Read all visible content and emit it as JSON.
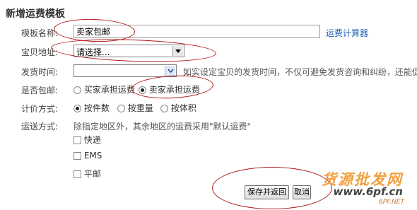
{
  "page_title": "新增运费模板",
  "template_name": {
    "label": "模板名称:",
    "value": "卖家包邮",
    "calc_link": "运费计算器"
  },
  "location": {
    "label": "宝贝地址:",
    "value": "请选择..."
  },
  "ship_time": {
    "label": "发货时间:",
    "value": "",
    "hint": "如实设定宝贝的发货时间，不仅可避免发货咨询和纠纷，还能促"
  },
  "free_shipping": {
    "label": "是否包邮:",
    "options": [
      "买家承担运费",
      "卖家承担运费"
    ],
    "selected": "卖家承担运费"
  },
  "pricing": {
    "label": "计价方式:",
    "options": [
      "按件数",
      "按重量",
      "按体积"
    ],
    "selected": "按件数"
  },
  "delivery": {
    "label": "运送方式:",
    "note": "除指定地区外，其余地区的运费采用\"默认运费\"",
    "options": [
      "快递",
      "EMS",
      "平邮"
    ]
  },
  "buttons": {
    "save": "保存并返回",
    "cancel": "取消"
  },
  "watermark": {
    "line1": "货源批发网",
    "line2": "www.6pf.cn",
    "line3": "6PF.NET"
  },
  "colors": {
    "annotation": "#b01818",
    "link": "#1a5fb4"
  }
}
